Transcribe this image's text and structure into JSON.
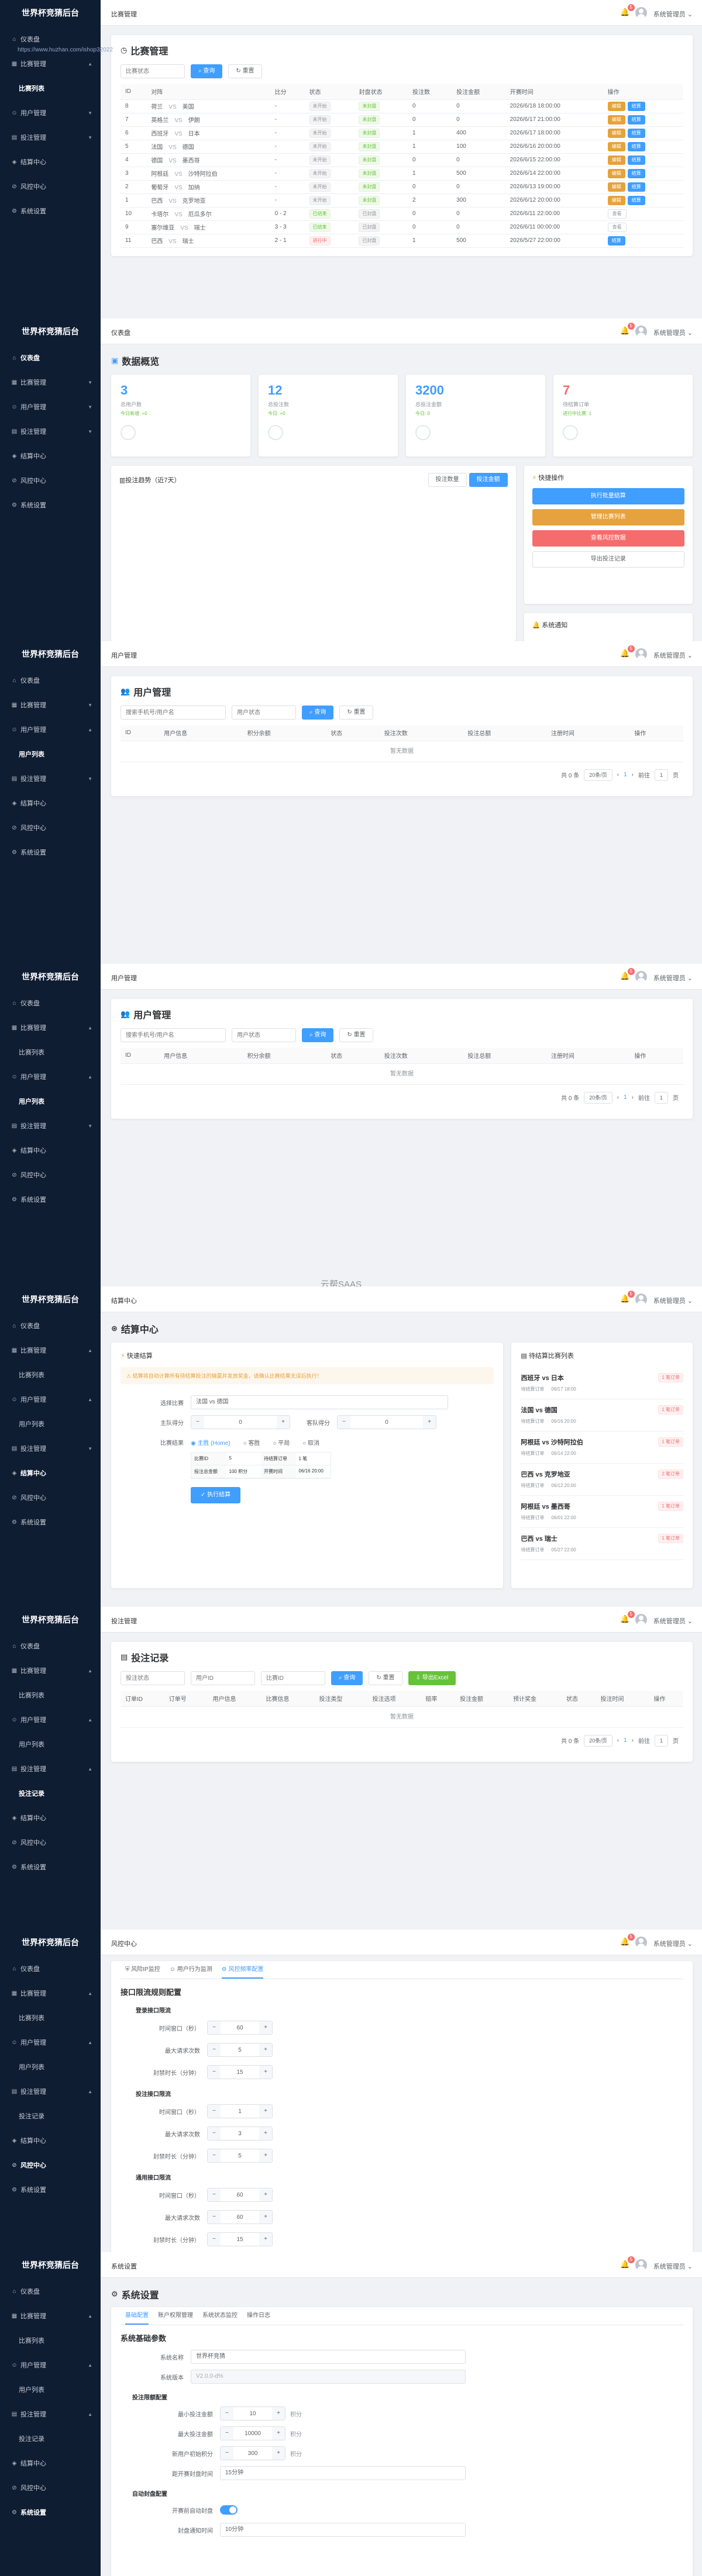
{
  "app": {
    "logo": "世界杯竞猜后台",
    "user": "系统管理员 ⌄",
    "notif_count": "5",
    "watermark": "https://www.huzhan.com/ishop32022",
    "watermark2": "云帮SAAS"
  },
  "nav_labels": {
    "dashboard": "仪表盘",
    "matches": "比赛管理",
    "match_list": "比赛列表",
    "users": "用户管理",
    "user_list": "用户列表",
    "bets": "投注管理",
    "bet_records": "投注记录",
    "settlement": "结算中心",
    "risk": "风控中心",
    "settings": "系统设置"
  },
  "matches": {
    "crumb": "比赛管理",
    "title": "比赛管理",
    "filter_placeholder": "比赛状态",
    "search": "查询",
    "reset": "重置",
    "columns": [
      "ID",
      "对阵",
      "比分",
      "状态",
      "封盘状态",
      "投注数",
      "投注金额",
      "开赛时间",
      "操作"
    ],
    "rows": [
      {
        "id": "8",
        "home": "荷兰",
        "away": "美国",
        "score": "-",
        "status": "未开始",
        "lock": "未封盘",
        "bets": "0",
        "amount": "0",
        "time": "2026/6/18 18:00:00",
        "ops": [
          "编辑",
          "结算"
        ]
      },
      {
        "id": "7",
        "home": "英格兰",
        "away": "伊朗",
        "score": "-",
        "status": "未开始",
        "lock": "未封盘",
        "bets": "0",
        "amount": "0",
        "time": "2026/6/17 21:00:00",
        "ops": [
          "编辑",
          "结算"
        ]
      },
      {
        "id": "6",
        "home": "西班牙",
        "away": "日本",
        "score": "-",
        "status": "未开始",
        "lock": "未封盘",
        "bets": "1",
        "amount": "400",
        "time": "2026/6/17 18:00:00",
        "ops": [
          "编辑",
          "结算"
        ]
      },
      {
        "id": "5",
        "home": "法国",
        "away": "德国",
        "score": "-",
        "status": "未开始",
        "lock": "未封盘",
        "bets": "1",
        "amount": "100",
        "time": "2026/6/16 20:00:00",
        "ops": [
          "编辑",
          "结算"
        ]
      },
      {
        "id": "4",
        "home": "德国",
        "away": "墨西哥",
        "score": "-",
        "status": "未开始",
        "lock": "未封盘",
        "bets": "0",
        "amount": "0",
        "time": "2026/6/15 22:00:00",
        "ops": [
          "编辑",
          "结算"
        ]
      },
      {
        "id": "3",
        "home": "阿根廷",
        "away": "沙特阿拉伯",
        "score": "-",
        "status": "未开始",
        "lock": "未封盘",
        "bets": "1",
        "amount": "500",
        "time": "2026/6/14 22:00:00",
        "ops": [
          "编辑",
          "结算"
        ]
      },
      {
        "id": "2",
        "home": "葡萄牙",
        "away": "加纳",
        "score": "-",
        "status": "未开始",
        "lock": "未封盘",
        "bets": "0",
        "amount": "0",
        "time": "2026/6/13 19:00:00",
        "ops": [
          "编辑",
          "结算"
        ]
      },
      {
        "id": "1",
        "home": "巴西",
        "away": "克罗地亚",
        "score": "-",
        "status": "未开始",
        "lock": "未封盘",
        "bets": "2",
        "amount": "300",
        "time": "2026/6/12 20:00:00",
        "ops": [
          "编辑",
          "结算"
        ]
      },
      {
        "id": "10",
        "home": "卡塔尔",
        "away": "厄瓜多尔",
        "score": "0 - 2",
        "status": "已结束",
        "lock": "已封盘",
        "bets": "0",
        "amount": "0",
        "time": "2026/6/11 22:00:00",
        "ops": [
          "查看"
        ]
      },
      {
        "id": "9",
        "home": "塞尔维亚",
        "away": "瑞士",
        "score": "3 - 3",
        "status": "已结束",
        "lock": "已封盘",
        "bets": "0",
        "amount": "0",
        "time": "2026/6/11 00:00:00",
        "ops": [
          "查看"
        ]
      },
      {
        "id": "11",
        "home": "巴西",
        "away": "瑞士",
        "score": "2 - 1",
        "status": "进行中",
        "lock": "已封盘",
        "bets": "1",
        "amount": "500",
        "time": "2026/5/27 22:00:00",
        "ops": [
          "结算"
        ]
      }
    ]
  },
  "dashboard": {
    "crumb": "仪表盘",
    "title": "数据概览",
    "stats": [
      {
        "num": "3",
        "label": "总用户数",
        "sub": "今日新增: +0",
        "color": "#409eff"
      },
      {
        "num": "12",
        "label": "总投注数",
        "sub": "今日: +0",
        "color": "#409eff"
      },
      {
        "num": "3200",
        "label": "总投注金额",
        "sub": "今日: 0",
        "color": "#409eff"
      },
      {
        "num": "7",
        "label": "待结算订单",
        "sub": "进行中比赛: 1",
        "color": "#f56c6c"
      }
    ],
    "trend_title": "投注趋势（近7天）",
    "trend_tabs": [
      "投注数量",
      "投注金额"
    ],
    "quick_title": "快捷操作",
    "quick_buttons": [
      "执行批量结算",
      "管理比赛列表",
      "查看风控数据",
      "导出投注记录"
    ],
    "notice_title": "系统通知"
  },
  "users": {
    "crumb": "用户管理",
    "title": "用户管理",
    "search_placeholder": "搜索手机号/用户名",
    "status_placeholder": "用户状态",
    "search": "查询",
    "reset": "重置",
    "columns": [
      "ID",
      "用户信息",
      "积分余额",
      "状态",
      "投注次数",
      "投注总额",
      "注册时间",
      "操作"
    ],
    "empty": "暂无数据",
    "total": "共 0 条",
    "page_size": "20条/页",
    "page": "1",
    "goto": "前往",
    "goto_val": "1",
    "page_unit": "页"
  },
  "settlement": {
    "crumb": "结算中心",
    "title": "结算中心",
    "quick_title": "快速结算",
    "warning": "结算将自动计算所有待结算投注的输赢并发放奖金，请确认比赛结果无误后执行！",
    "match_label": "选择比赛",
    "match_value": "法国 vs 德国",
    "home_label": "主队得分",
    "home_score": "0",
    "away_label": "客队得分",
    "away_score": "0",
    "result_label": "比赛结果",
    "results": [
      "主胜 (Home)",
      "客胜",
      "平局",
      "取消"
    ],
    "info": [
      [
        "比赛ID",
        "5",
        "待结算订单",
        "1 笔"
      ],
      [
        "投注总金额",
        "100 积分",
        "开赛时间",
        "06/16 20:00"
      ]
    ],
    "exec": "执行结算",
    "pending_title": "待结算比赛列表",
    "pending": [
      {
        "name": "西班牙 vs 日本",
        "orders": "1 笔订单",
        "sub": "待结算订单",
        "time": "06/17 18:00"
      },
      {
        "name": "法国 vs 德国",
        "orders": "1 笔订单",
        "sub": "待结算订单",
        "time": "06/16 20:00"
      },
      {
        "name": "阿根廷 vs 沙特阿拉伯",
        "orders": "1 笔订单",
        "sub": "待结算订单",
        "time": "06/14 22:00"
      },
      {
        "name": "巴西 vs 克罗地亚",
        "orders": "2 笔订单",
        "sub": "待结算订单",
        "time": "06/12 20:00"
      },
      {
        "name": "阿根廷 vs 墨西哥",
        "orders": "1 笔订单",
        "sub": "待结算订单",
        "time": "06/01 22:00"
      },
      {
        "name": "巴西 vs 瑞士",
        "orders": "1 笔订单",
        "sub": "待结算订单",
        "time": "05/27 22:00"
      }
    ]
  },
  "bets": {
    "crumb": "投注管理",
    "title": "投注记录",
    "status_placeholder": "投注状态",
    "user_placeholder": "用户ID",
    "match_placeholder": "比赛ID",
    "search": "查询",
    "reset": "重置",
    "export": "导出Excel",
    "columns": [
      "订单ID",
      "订单号",
      "用户信息",
      "比赛信息",
      "投注类型",
      "投注选项",
      "赔率",
      "投注金额",
      "预计奖金",
      "状态",
      "投注时间",
      "操作"
    ],
    "empty": "暂无数据"
  },
  "risk": {
    "crumb": "风控中心",
    "tabs": [
      "风险IP监控",
      "用户行为监测",
      "风控频率配置"
    ],
    "title": "接口限流规则配置",
    "sections": [
      {
        "name": "登录接口限流",
        "rows": [
          [
            "时间窗口（秒）",
            "60"
          ],
          [
            "最大请求次数",
            "5"
          ],
          [
            "封禁时长（分钟）",
            "15"
          ]
        ]
      },
      {
        "name": "投注接口限流",
        "rows": [
          [
            "时间窗口（秒）",
            "1"
          ],
          [
            "最大请求次数",
            "3"
          ],
          [
            "封禁时长（分钟）",
            "5"
          ]
        ]
      },
      {
        "name": "通用接口限流",
        "rows": [
          [
            "时间窗口（秒）",
            "60"
          ],
          [
            "最大请求次数",
            "60"
          ],
          [
            "封禁时长（分钟）",
            "15"
          ]
        ]
      }
    ]
  },
  "settings": {
    "crumb": "系统设置",
    "title": "系统设置",
    "tabs": [
      "基础配置",
      "账户权限管理",
      "系统状态监控",
      "操作日志"
    ],
    "section": "系统基础参数",
    "sys_name_label": "系统名称",
    "sys_name": "世界杯竞猜",
    "version_label": "系统版本",
    "version": "V2.0.0-d%",
    "limit_title": "投注限额配置",
    "limits": [
      [
        "最小投注金额",
        "10",
        "积分"
      ],
      [
        "最大投注金额",
        "10000",
        "积分"
      ],
      [
        "新用户初始积分",
        "300",
        "积分"
      ]
    ],
    "close_label": "距开赛封盘时间",
    "close_value": "15分钟",
    "auto_title": "自动封盘配置",
    "auto_label": "开赛前自动封盘",
    "freq_label": "封盘通知时间",
    "freq_value": "10分钟"
  }
}
